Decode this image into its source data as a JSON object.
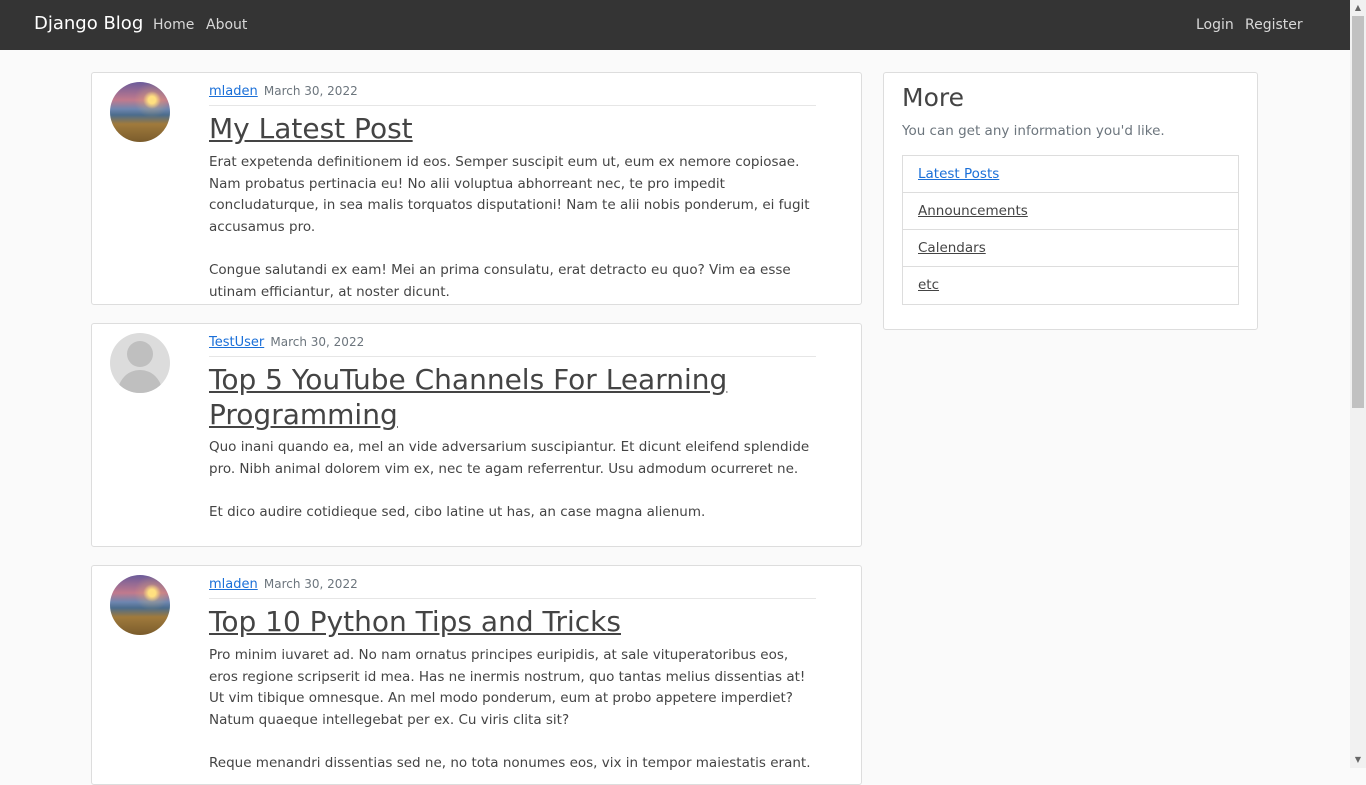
{
  "navbar": {
    "brand": "Django Blog",
    "left_links": [
      "Home",
      "About"
    ],
    "right_links": [
      "Login",
      "Register"
    ]
  },
  "posts": [
    {
      "author": "mladen",
      "date": "March 30, 2022",
      "title": "My Latest Post",
      "avatar": "landscape",
      "content": "Erat expetenda definitionem id eos. Semper suscipit eum ut, eum ex nemore copiosae. Nam probatus pertinacia eu! No alii voluptua abhorreant nec, te pro impedit concludaturque, in sea malis torquatos disputationi! Nam te alii nobis ponderum, ei fugit accusamus pro.\n\nCongue salutandi ex eam! Mei an prima consulatu, erat detracto eu quo? Vim ea esse utinam efficiantur, at noster dicunt."
    },
    {
      "author": "TestUser",
      "date": "March 30, 2022",
      "title": "Top 5 YouTube Channels For Learning Programming",
      "avatar": "default",
      "content": "Quo inani quando ea, mel an vide adversarium suscipiantur. Et dicunt eleifend splendide pro. Nibh animal dolorem vim ex, nec te agam referrentur. Usu admodum ocurreret ne.\n\nEt dico audire cotidieque sed, cibo latine ut has, an case magna alienum."
    },
    {
      "author": "mladen",
      "date": "March 30, 2022",
      "title": "Top 10 Python Tips and Tricks",
      "avatar": "landscape",
      "content": "Pro minim iuvaret ad. No nam ornatus principes euripidis, at sale vituperatoribus eos, eros regione scripserit id mea. Has ne inermis nostrum, quo tantas melius dissentias at! Ut vim tibique omnesque. An mel modo ponderum, eum at probo appetere imperdiet? Natum quaeque intellegebat per ex. Cu viris clita sit?\n\nReque menandri dissentias sed ne, no tota nonumes eos, vix in tempor maiestatis erant."
    }
  ],
  "sidebar": {
    "title": "More",
    "subtitle": "You can get any information you'd like.",
    "items": [
      "Latest Posts",
      "Announcements",
      "Calendars",
      "etc"
    ]
  },
  "colors": {
    "navbar": "#343434",
    "link": "#1a6fd8",
    "text": "#444444",
    "muted": "#6c757d"
  }
}
